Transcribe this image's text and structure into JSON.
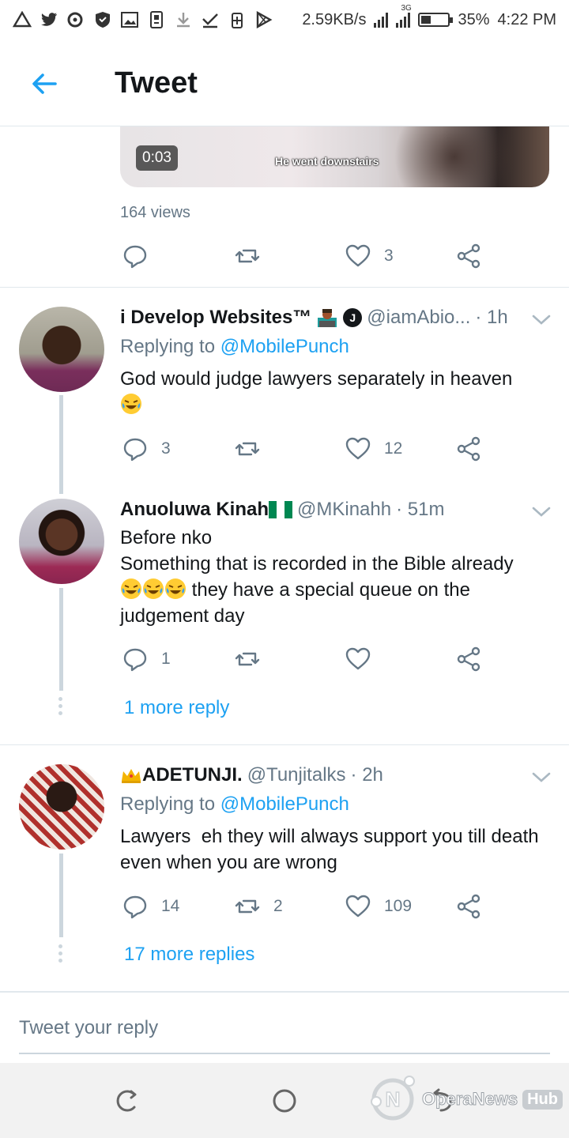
{
  "status_bar": {
    "network_speed": "2.59KB/s",
    "net_type": "3G",
    "battery": "35%",
    "battery_fraction": 0.35,
    "time": "4:22 PM",
    "icons": [
      "drive-icon",
      "twitter-icon",
      "chat-icon",
      "shield-icon",
      "image-icon",
      "clipboard-icon",
      "download-icon",
      "check-icon",
      "battery-saver-icon",
      "play-store-icon"
    ]
  },
  "header": {
    "title": "Tweet",
    "back_icon": "back-arrow-icon"
  },
  "main_tweet": {
    "video_time": "0:03",
    "video_caption": "He went downstairs",
    "views": "164 views",
    "reply_count": "",
    "retweet_count": "",
    "like_count": "3"
  },
  "replies": [
    {
      "name": "i Develop Websites™",
      "badge": "J",
      "handle": "@iamAbio...",
      "time": "· 1h",
      "replying_prefix": "Replying to",
      "replying_to": "@MobilePunch",
      "text": "God would judge lawyers separately in heaven",
      "reply_count": "3",
      "retweet_count": "",
      "like_count": "12"
    },
    {
      "name": "Anuoluwa Kinah",
      "handle": "@MKinahh",
      "time": "· 51m",
      "text_line1": "Before nko",
      "text_line2": "Something that is recorded in the Bible already",
      "text_line3": "they have a special queue on the",
      "text_line4": "judgement day",
      "reply_count": "1",
      "retweet_count": "",
      "like_count": "",
      "more_replies": "1 more reply"
    },
    {
      "name": "ADETUNJI.",
      "handle": "@Tunjitalks",
      "time": "· 2h",
      "replying_prefix": "Replying to",
      "replying_to": "@MobilePunch",
      "text": "Lawyers  eh they will always support you till death even when you are wrong",
      "reply_count": "14",
      "retweet_count": "2",
      "like_count": "109",
      "more_replies": "17 more replies"
    }
  ],
  "compose": {
    "placeholder": "Tweet your reply"
  },
  "nav": {
    "buttons": [
      "recents-icon",
      "home-icon",
      "back-icon"
    ]
  },
  "watermark": {
    "text": "OperaNews",
    "suffix": "Hub"
  },
  "colors": {
    "accent": "#1da1f2",
    "secondary_text": "#657786",
    "border": "#e1e8ed"
  }
}
